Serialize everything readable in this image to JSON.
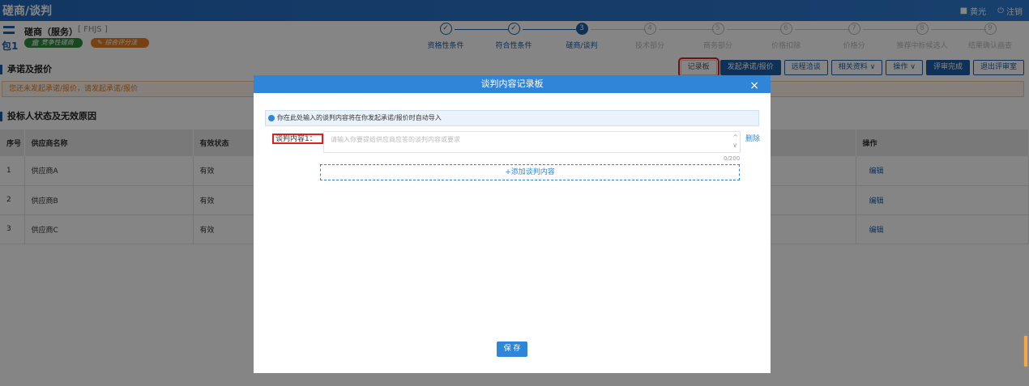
{
  "topbar": {
    "title": "磋商/谈判",
    "user": "黄光",
    "logout": "注销"
  },
  "package": {
    "id": "包1",
    "name": "磋商（服务）",
    "code": "[ FHJS ]",
    "badge1": "竞争性磋商",
    "badge2": "综合评分法"
  },
  "steps": [
    {
      "num": "✓",
      "label": "资格性条件",
      "state": "done"
    },
    {
      "num": "✓",
      "label": "符合性条件",
      "state": "done"
    },
    {
      "num": "3",
      "label": "磋商/谈判",
      "state": "active"
    },
    {
      "num": "4",
      "label": "技术部分",
      "state": "pending"
    },
    {
      "num": "5",
      "label": "商务部分",
      "state": "pending"
    },
    {
      "num": "6",
      "label": "价格扣除",
      "state": "pending"
    },
    {
      "num": "7",
      "label": "价格分",
      "state": "pending"
    },
    {
      "num": "8",
      "label": "推荐中标候选人",
      "state": "pending"
    },
    {
      "num": "9",
      "label": "结果确认画查",
      "state": "pending"
    }
  ],
  "section1": {
    "title": "承诺及报价",
    "warning": "您还未发起承诺/报价，请发起承诺/报价"
  },
  "toolbar": {
    "record": "记录板",
    "initiate": "发起承诺/报价",
    "remote": "远程洽谈",
    "materials": "相关资料",
    "ops": "操作",
    "finish": "评审完成",
    "exit": "退出评审室"
  },
  "section2": {
    "title": "投标人状态及无效原因"
  },
  "table": {
    "headers": [
      "序号",
      "供应商名称",
      "有效状态",
      "操作"
    ],
    "rows": [
      {
        "no": "1",
        "name": "供应商A",
        "status": "有效",
        "op": "编辑"
      },
      {
        "no": "2",
        "name": "供应商B",
        "status": "有效",
        "op": "编辑"
      },
      {
        "no": "3",
        "name": "供应商C",
        "status": "有效",
        "op": "编辑"
      }
    ]
  },
  "modal": {
    "title": "谈判内容记录板",
    "close": "×",
    "notice": "你在此处输入的谈判内容将在你发起承诺/报价时自动导入",
    "field_label": "谈判内容1：",
    "placeholder": "请输入你要提给供应商应答的谈判内容或要求",
    "counter": "0/200",
    "delete": "删除",
    "add": "添加谈判内容",
    "save": "保 存"
  }
}
